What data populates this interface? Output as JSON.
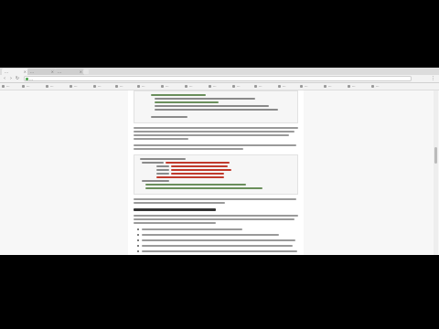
{
  "browser": {
    "tabs": [
      {
        "label": "…"
      },
      {
        "label": "…"
      },
      {
        "label": "…"
      }
    ],
    "address_bar": "…",
    "bookmarks": [
      "…",
      "…",
      "…",
      "…",
      "…",
      "…",
      "…",
      "…",
      "…",
      "…",
      "…",
      "…",
      "…",
      "…",
      "…",
      "…",
      "…"
    ]
  },
  "article": {
    "heading": "…"
  }
}
